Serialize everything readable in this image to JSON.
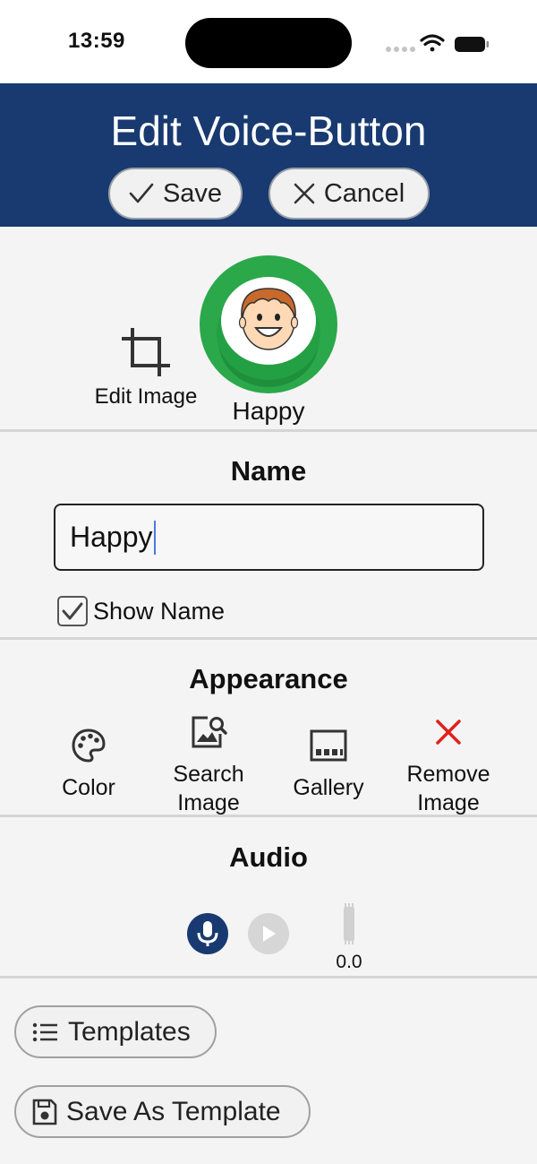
{
  "status_bar": {
    "time": "13:59",
    "icons": [
      "signal-icon",
      "wifi-icon",
      "battery-icon"
    ]
  },
  "header": {
    "title": "Edit Voice-Button",
    "save_label": "Save",
    "cancel_label": "Cancel"
  },
  "preview": {
    "edit_image_label": "Edit Image",
    "button_name": "Happy",
    "button_color": "#2aa84a"
  },
  "name_section": {
    "title": "Name",
    "value": "Happy",
    "show_name_label": "Show Name",
    "show_name_checked": true
  },
  "appearance": {
    "title": "Appearance",
    "items": [
      {
        "label": "Color",
        "icon": "palette-icon"
      },
      {
        "label": "Search Image",
        "icon": "image-search-icon"
      },
      {
        "label": "Gallery",
        "icon": "gallery-icon"
      },
      {
        "label": "Remove Image",
        "icon": "close-icon"
      }
    ]
  },
  "audio": {
    "title": "Audio",
    "duration": "0.0"
  },
  "footer": {
    "templates_label": "Templates",
    "save_as_template_label": "Save As Template"
  },
  "colors": {
    "header_bg": "#183a70",
    "accent": "#183a70",
    "remove_red": "#e0201e",
    "background": "#f4f4f4"
  }
}
